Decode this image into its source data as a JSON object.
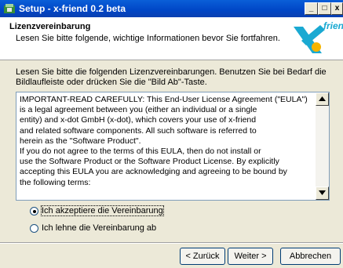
{
  "window": {
    "title": "Setup - x-friend 0.2 beta",
    "controls": [
      "_",
      "□",
      "x"
    ]
  },
  "header": {
    "title": "Lizenzvereinbarung",
    "subtitle": "Lesen Sie bitte folgende, wichtige Informationen bevor Sie fortfahren.",
    "logo_text": "friend",
    "logo_colors": {
      "blue": "#1aa9d2",
      "orange": "#f5b400"
    }
  },
  "intro": {
    "line1": "Lesen Sie bitte die folgenden Lizenzvereinbarungen. Benutzen Sie bei Bedarf die",
    "line2": "Bildlaufleiste oder drücken Sie die \"Bild Ab\"-Taste."
  },
  "license_lines": [
    "IMPORTANT-READ CAREFULLY: This End-User License Agreement (\"EULA\")",
    "is a legal agreement between you (either an individual or a single",
    "entity) and x-dot GmbH (x-dot), which covers your use of x-friend",
    "and related software components. All such software is referred to",
    "herein as the \"Software Product\".",
    "If you do not agree to the terms of this EULA, then do not install or",
    "use the Software Product or the Software Product License. By explicitly",
    "accepting this EULA you are acknowledging and agreeing to be bound by",
    "the following terms:"
  ],
  "options": {
    "accept": {
      "label": "Ich akzeptiere die Vereinbarung",
      "checked": true
    },
    "decline": {
      "label": "Ich lehne die Vereinbarung ab",
      "checked": false
    }
  },
  "buttons": {
    "back": "< Zurück",
    "next": "Weiter >",
    "cancel": "Abbrechen"
  }
}
